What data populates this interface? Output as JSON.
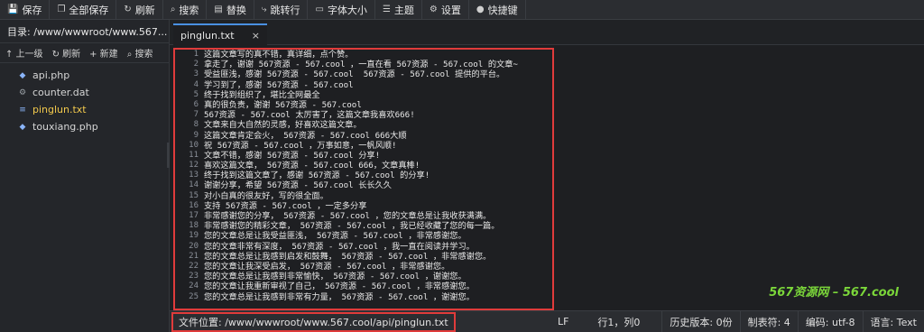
{
  "toolbar": {
    "items": [
      {
        "icon": "save-icon",
        "glyph": "💾",
        "label": "保存"
      },
      {
        "icon": "save-all-icon",
        "glyph": "❐",
        "label": "全部保存"
      },
      {
        "icon": "refresh-icon",
        "glyph": "↻",
        "label": "刷新"
      },
      {
        "icon": "search-icon",
        "glyph": "⌕",
        "label": "搜索"
      },
      {
        "icon": "replace-icon",
        "glyph": "▤",
        "label": "替换"
      },
      {
        "icon": "goto-line-icon",
        "glyph": "⤷",
        "label": "跳转行"
      },
      {
        "icon": "font-size-icon",
        "glyph": "▭",
        "label": "字体大小"
      },
      {
        "icon": "theme-icon",
        "glyph": "☰",
        "label": "主题"
      },
      {
        "icon": "settings-icon",
        "glyph": "⚙",
        "label": "设置"
      },
      {
        "icon": "shortcut-icon",
        "glyph": "●",
        "label": "快捷键"
      }
    ]
  },
  "sidebar": {
    "directory": "目录: /www/wwwroot/www.567...",
    "tools": {
      "up": "↑ 上一级",
      "refresh": "↻ 刷新",
      "new": "+ 新建",
      "search": "⌕ 搜索"
    },
    "files": [
      {
        "name": "api.php",
        "icon": "php-file-icon",
        "glyph": "◆"
      },
      {
        "name": "counter.dat",
        "icon": "file-gear-icon",
        "glyph": "⚙"
      },
      {
        "name": "pinglun.txt",
        "icon": "text-file-icon",
        "glyph": "≡"
      },
      {
        "name": "touxiang.php",
        "icon": "php-file-icon",
        "glyph": "◆"
      }
    ]
  },
  "tab": {
    "label": "pinglun.txt",
    "close": "×"
  },
  "editor": {
    "lines": [
      "这篇文章写的真不错，真详细，点个赞。",
      "拿走了，谢谢 567资源 - 567.cool ，一直在看 567资源 - 567.cool 的文章~",
      "受益匪浅，感谢 567资源 - 567.cool  567资源 - 567.cool 提供的平台。",
      "学习到了，感谢 567资源 - 567.cool",
      "终于找到组织了，堪比全网最全",
      "真的很负责，谢谢 567资源 - 567.cool",
      "567资源 - 567.cool 太厉害了，这篇文章我喜欢666!",
      "文章来自大自然的灵感，好喜欢这篇文章。",
      "这篇文章肯定会火， 567资源 - 567.cool 666大顺",
      "祝 567资源 - 567.cool ，万事如意，一帆风顺!",
      "文章不错，感谢 567资源 - 567.cool 分享!",
      "喜欢这篇文章， 567资源 - 567.cool 666，文章真棒!",
      "终于找到这篇文章了，感谢 567资源 - 567.cool 的分享!",
      "谢谢分享，希望 567资源 - 567.cool 长长久久",
      "对小白真的很友好，写的很全面。",
      "支持 567资源 - 567.cool ，一定多分享",
      "非常感谢您的分享， 567资源 - 567.cool ，您的文章总是让我收获满满。",
      "非常感谢您的精彩文章， 567资源 - 567.cool ，我已经收藏了您的每一篇。",
      "您的文章总是让我受益匪浅， 567资源 - 567.cool ，非常感谢您。",
      "您的文章非常有深度， 567资源 - 567.cool ，我一直在阅读并学习。",
      "您的文章总是让我感到启发和鼓舞， 567资源 - 567.cool ，非常感谢您。",
      "您的文章让我深受启发， 567资源 - 567.cool ，非常感谢您。",
      "您的文章总是让我感到非常愉快， 567资源 - 567.cool ，谢谢您。",
      "您的文章让我重新审视了自己， 567资源 - 567.cool ，非常感谢您。",
      "您的文章总是让我感到非常有力量， 567资源 - 567.cool ，谢谢您。"
    ],
    "watermark": "567资源网 – 567.cool"
  },
  "status": {
    "file_path": "文件位置: /www/wwwroot/www.567.cool/api/pinglun.txt",
    "line_ending": "LF",
    "cursor": "行1，列0",
    "history": "历史版本: 0份",
    "tab_size": "制表符: 4",
    "encoding": "编码: utf-8",
    "language": "语言: Text"
  }
}
